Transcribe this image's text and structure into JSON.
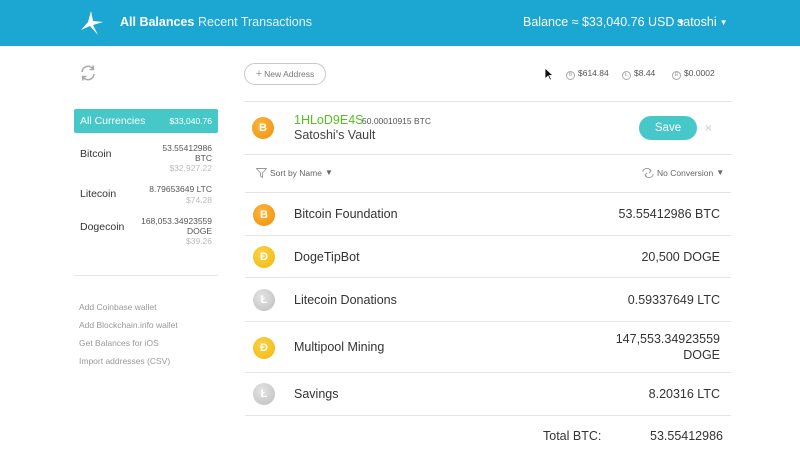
{
  "topbar": {
    "nav": {
      "all_balances": "All Balances",
      "recent_transactions": "Recent Transactions"
    },
    "balance": "Balance ≈ $33,040.76 USD",
    "user": "satoshi",
    "color": "#1ba7d2"
  },
  "toolbar": {
    "new_address": "New Address",
    "rates": {
      "btc": "$614.84",
      "ltc": "$8.44",
      "doge": "$0.0002"
    }
  },
  "sidebar": {
    "all": {
      "label": "All Currencies",
      "value": "$33,040.76"
    },
    "currencies": [
      {
        "name": "Bitcoin",
        "amount": "53.55412986",
        "unit": "BTC",
        "usd": "$32,927.22"
      },
      {
        "name": "Litecoin",
        "amount": "8.79653649 LTC",
        "usd": "$74.28"
      },
      {
        "name": "Dogecoin",
        "amount": "168,053.34923559",
        "unit": "DOGE",
        "usd": "$39.26"
      }
    ],
    "links": [
      "Add Coinbase wallet",
      "Add Blockchain.info wallet",
      "Get Balances for iOS",
      "Import addresses (CSV)"
    ]
  },
  "editor": {
    "address": "1HLoD9E4S",
    "amount": "50.00010915 BTC",
    "label": "Satoshi's Vault",
    "save": "Save",
    "close": "×"
  },
  "controls": {
    "sort": "Sort by Name",
    "conversion": "No Conversion"
  },
  "rows": [
    {
      "coin": "B",
      "name": "Bitcoin Foundation",
      "amount": "53.55412986 BTC"
    },
    {
      "coin": "Ð",
      "name": "DogeTipBot",
      "amount": "20,500 DOGE"
    },
    {
      "coin": "Ł",
      "name": "Litecoin Donations",
      "amount": "0.59337649 LTC"
    },
    {
      "coin": "Ð",
      "name": "Multipool Mining",
      "amount": "147,553.34923559",
      "amount2": "DOGE"
    },
    {
      "coin": "Ł",
      "name": "Savings",
      "amount": "8.20316 LTC"
    }
  ],
  "total": {
    "label": "Total BTC:",
    "value": "53.55412986"
  },
  "colors": {
    "accent": "#47c8c8",
    "address": "#54c21c",
    "btc": "#f39c1c",
    "doge": "#f4c41e",
    "ltc": "#c8c8c8"
  }
}
